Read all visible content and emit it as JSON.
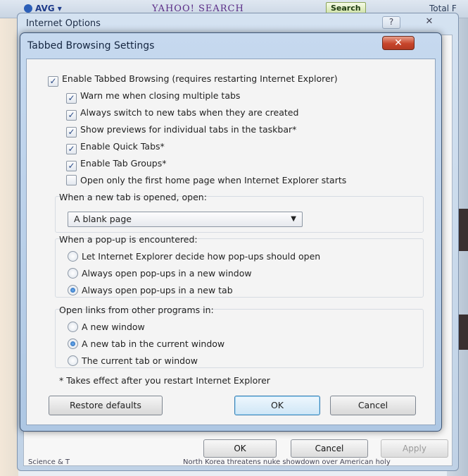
{
  "browser": {
    "avg_label": "AVG ▾",
    "yahoo_label": "YAHOO! SEARCH",
    "search_button": "Search",
    "total_label": "Total F"
  },
  "io_window": {
    "title": "Internet Options",
    "help_glyph": "?",
    "close_glyph": "✕",
    "ok_label": "OK",
    "cancel_label": "Cancel",
    "apply_label": "Apply",
    "status_left": "Science & T",
    "status_right": "North Korea threatens nuke showdown over American holy"
  },
  "dialog": {
    "title": "Tabbed Browsing Settings",
    "close_glyph": "✕",
    "enable_tabbed": {
      "label": "Enable Tabbed Browsing (requires restarting Internet Explorer)",
      "checked": true
    },
    "options": [
      {
        "label": "Warn me when closing multiple tabs",
        "checked": true
      },
      {
        "label": "Always switch to new tabs when they are created",
        "checked": true
      },
      {
        "label": "Show previews for individual tabs in the taskbar*",
        "checked": true
      },
      {
        "label": "Enable Quick Tabs*",
        "checked": true
      },
      {
        "label": "Enable Tab Groups*",
        "checked": true
      },
      {
        "label": "Open only the first home page when Internet Explorer starts",
        "checked": false
      }
    ],
    "new_tab_label": "When a new tab is opened, open:",
    "new_tab_value": "A blank page",
    "popup_label": "When a pop-up is encountered:",
    "popup_options": [
      {
        "label": "Let Internet Explorer decide how pop-ups should open",
        "selected": false
      },
      {
        "label": "Always open pop-ups in a new window",
        "selected": false
      },
      {
        "label": "Always open pop-ups in a new tab",
        "selected": true
      }
    ],
    "links_label": "Open links from other programs in:",
    "links_options": [
      {
        "label": "A new window",
        "selected": false
      },
      {
        "label": "A new tab in the current window",
        "selected": true
      },
      {
        "label": "The current tab or window",
        "selected": false
      }
    ],
    "footnote": "* Takes effect after you restart Internet Explorer",
    "restore_label": "Restore defaults",
    "ok_label": "OK",
    "cancel_label": "Cancel",
    "check_glyph": "✓"
  }
}
